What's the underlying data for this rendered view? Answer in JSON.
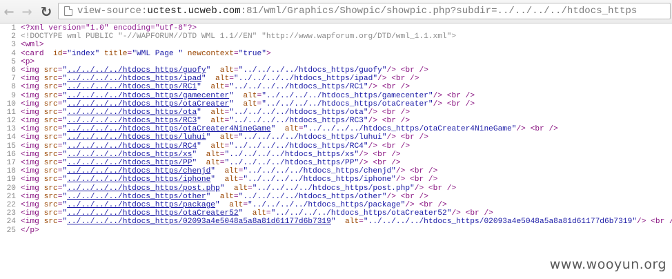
{
  "toolbar": {
    "back_icon": "←",
    "forward_icon": "→",
    "reload_icon": "↻",
    "url_prefix": "view-source:",
    "url_host": "uctest.ucweb.com",
    "url_rest": ":81/wml/Graphics/Showpic/showpic.php?subdir=../../../../htdocs_https"
  },
  "source": {
    "line1": "<?xml version=\"1.0\" encoding=\"utf-8\"?>",
    "line2": "<!DOCTYPE wml PUBLIC \"-//WAPFORUM//DTD WML 1.1//EN\" \"http://www.wapforum.org/DTD/wml_1.1.xml\">",
    "line3": "<wml>",
    "card": {
      "id": "index",
      "title": "WML Page ",
      "newcontext": "true"
    },
    "p_open": "<p>",
    "images": [
      {
        "src": "../../../../htdocs_https/guofy",
        "alt": "../../../../htdocs_https/guofy"
      },
      {
        "src": "../../../../htdocs_https/ipad",
        "alt": "../../../../htdocs_https/ipad"
      },
      {
        "src": "../../../../htdocs_https/RC1",
        "alt": "../../../../htdocs_https/RC1"
      },
      {
        "src": "../../../../htdocs_https/gamecenter",
        "alt": "../../../../htdocs_https/gamecenter"
      },
      {
        "src": "../../../../htdocs_https/otaCreater",
        "alt": "../../../../htdocs_https/otaCreater"
      },
      {
        "src": "../../../../htdocs_https/ota",
        "alt": "../../../../htdocs_https/ota"
      },
      {
        "src": "../../../../htdocs_https/RC3",
        "alt": "../../../../htdocs_https/RC3"
      },
      {
        "src": "../../../../htdocs_https/otaCreater4NineGame",
        "alt": "../../../../htdocs_https/otaCreater4NineGame"
      },
      {
        "src": "../../../../htdocs_https/luhui",
        "alt": "../../../../htdocs_https/luhui"
      },
      {
        "src": "../../../../htdocs_https/RC4",
        "alt": "../../../../htdocs_https/RC4"
      },
      {
        "src": "../../../../htdocs_https/xs",
        "alt": "../../../../htdocs_https/xs"
      },
      {
        "src": "../../../../htdocs_https/PP",
        "alt": "../../../../htdocs_https/PP"
      },
      {
        "src": "../../../../htdocs_https/chenjd",
        "alt": "../../../../htdocs_https/chenjd"
      },
      {
        "src": "../../../../htdocs_https/iphone",
        "alt": "../../../../htdocs_https/iphone"
      },
      {
        "src": "../../../../htdocs_https/post.php",
        "alt": "../../../../htdocs_https/post.php"
      },
      {
        "src": "../../../../htdocs_https/other",
        "alt": "../../../../htdocs_https/other"
      },
      {
        "src": "../../../../htdocs_https/package",
        "alt": "../../../../htdocs_https/package"
      },
      {
        "src": "../../../../htdocs_https/otaCreater52",
        "alt": "../../../../htdocs_https/otaCreater52"
      },
      {
        "src": "../../../../htdocs_https/02093a4e5048a5a8a81d61177d6b7319",
        "alt": "../../../../htdocs_https/02093a4e5048a5a8a81d61177d6b7319"
      }
    ],
    "p_close": "</p>"
  },
  "watermark": "www.wooyun.org",
  "colors": {
    "tag": "#881280",
    "attribute": "#994500",
    "value": "#1a1aa6",
    "line_number": "#8c8c8c"
  }
}
